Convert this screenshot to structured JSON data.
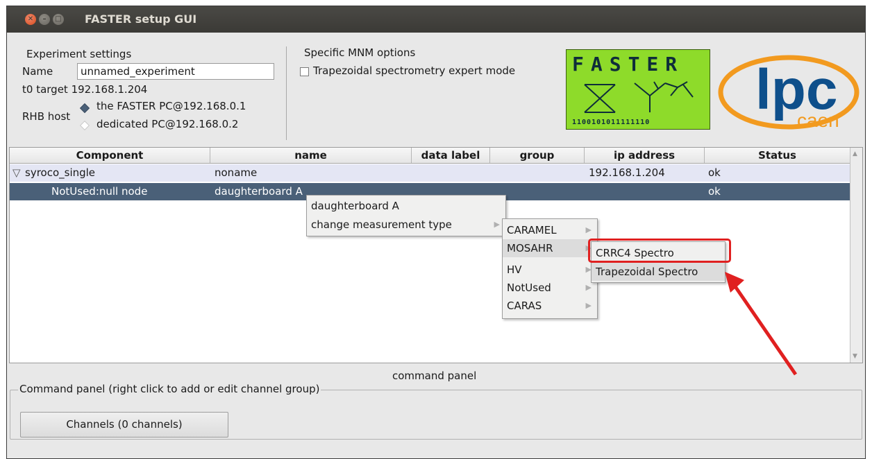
{
  "window": {
    "title": "FASTER setup GUI"
  },
  "experiment": {
    "heading": "Experiment settings",
    "name_label": "Name",
    "name_value": "unnamed_experiment",
    "t0_label": "t0 target",
    "t0_value": "192.168.1.204",
    "rhb_label": "RHB host",
    "rhb_options": [
      "the FASTER PC@192.168.0.1",
      "dedicated PC@192.168.0.2"
    ],
    "rhb_selected": 0
  },
  "mnm": {
    "heading": "Specific MNM options",
    "checkbox_label": "Trapezoidal spectrometry expert mode",
    "checked": false
  },
  "logos": {
    "faster_word": "FASTER",
    "faster_bits": "1100101011111110",
    "lpc_text": "lpc",
    "caen_text": "caen",
    "faster_color": "#8edb2a",
    "lpc_color": "#0e4f8b",
    "caen_color": "#f29a1f"
  },
  "table": {
    "columns": [
      "Component",
      "name",
      "data label",
      "group",
      "ip address",
      "Status"
    ],
    "rows": [
      {
        "component": "syroco_single",
        "name": "noname",
        "data_label": "",
        "group": "",
        "ip": "192.168.1.204",
        "status": "ok",
        "expanded": true
      },
      {
        "component": "NotUsed:null node",
        "name": "daughterboard A",
        "data_label": "",
        "group": "",
        "ip": "",
        "status": "ok",
        "selected": true
      }
    ]
  },
  "context_menu": {
    "items": [
      "daughterboard A",
      "change measurement type"
    ],
    "submenu": [
      "CARAMEL",
      "MOSAHR",
      "HV",
      "NotUsed",
      "CARAS"
    ],
    "subsubmenu": [
      "CRRC4 Spectro",
      "Trapezoidal Spectro"
    ]
  },
  "command_panel": {
    "title": "command panel",
    "group_label": "Command panel (right click to add or edit channel group)",
    "channels_button": "Channels (0 channels)"
  },
  "colors": {
    "selected_row": "#4a6078",
    "highlight_row": "#e4e6f4",
    "annotation_red": "#e02020"
  }
}
